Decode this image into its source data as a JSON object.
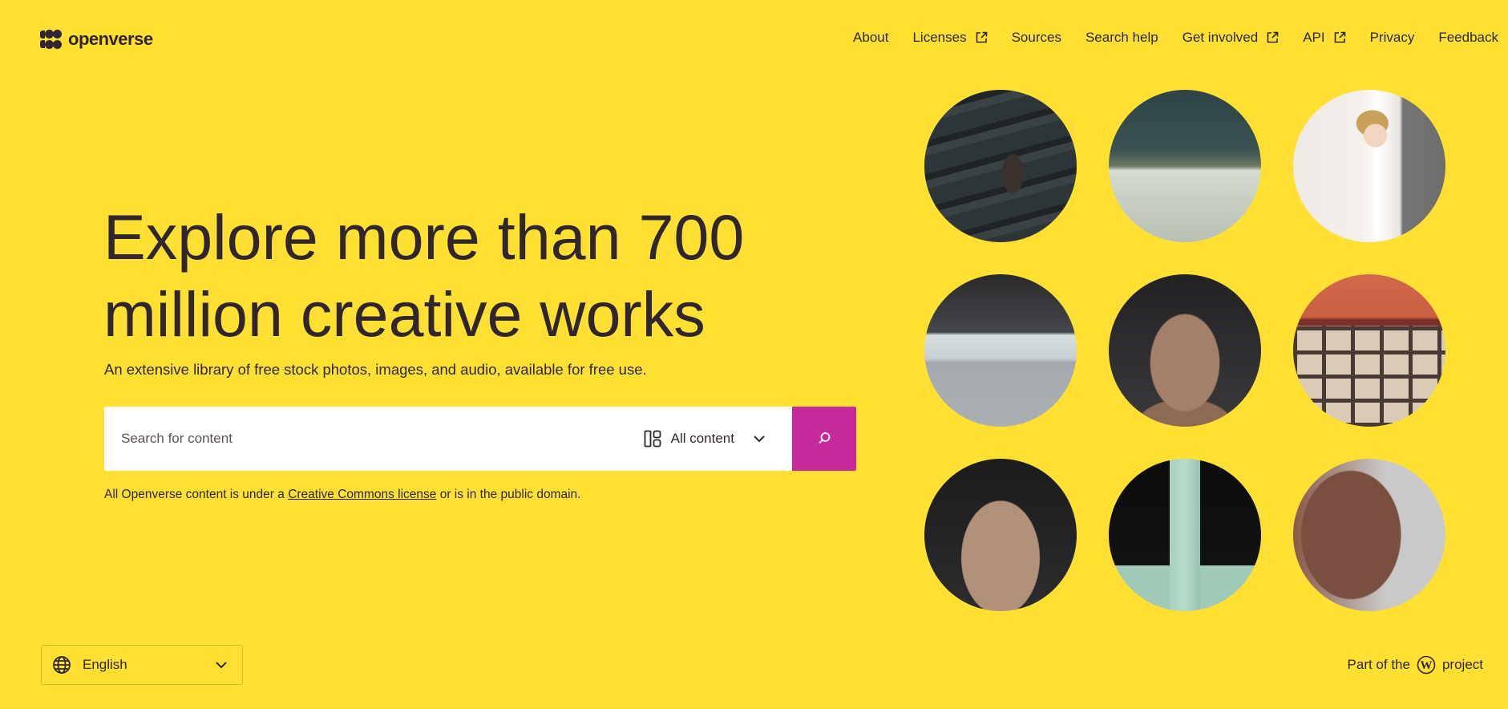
{
  "header": {
    "logo_text": "openverse",
    "nav": [
      {
        "label": "About",
        "external": false
      },
      {
        "label": "Licenses",
        "external": true
      },
      {
        "label": "Sources",
        "external": false
      },
      {
        "label": "Search help",
        "external": false
      },
      {
        "label": "Get involved",
        "external": true
      },
      {
        "label": "API",
        "external": true
      },
      {
        "label": "Privacy",
        "external": false
      },
      {
        "label": "Feedback",
        "external": false
      }
    ]
  },
  "hero": {
    "title_line1": "Explore more than 700",
    "title_line2": "million creative works",
    "subtitle": "An extensive library of free stock photos, images, and audio, available for free use."
  },
  "search": {
    "placeholder": "Search for content",
    "value": "",
    "content_type": "All content",
    "button_label": "Search"
  },
  "license_note": {
    "prefix": "All Openverse content is under a ",
    "link": "Creative Commons license",
    "suffix": " or is in the public domain."
  },
  "gallery": [
    {
      "subject": "dark stone vessel with scroll handle"
    },
    {
      "subject": "celadon glazed bowl"
    },
    {
      "subject": "porcelain figurine of a boy"
    },
    {
      "subject": "white porcelain bowl"
    },
    {
      "subject": "clay figurine holding hand to face"
    },
    {
      "subject": "painted pottery bowl with checker pattern"
    },
    {
      "subject": "carved stone figure with headdress"
    },
    {
      "subject": "celadon five-spouted vase"
    },
    {
      "subject": "terracotta head in profile"
    }
  ],
  "footer": {
    "language": "English",
    "wp_prefix": "Part of the",
    "wp_suffix": "project"
  },
  "colors": {
    "background": "#ffe033",
    "accent": "#c52b9b",
    "text": "#30272e"
  }
}
